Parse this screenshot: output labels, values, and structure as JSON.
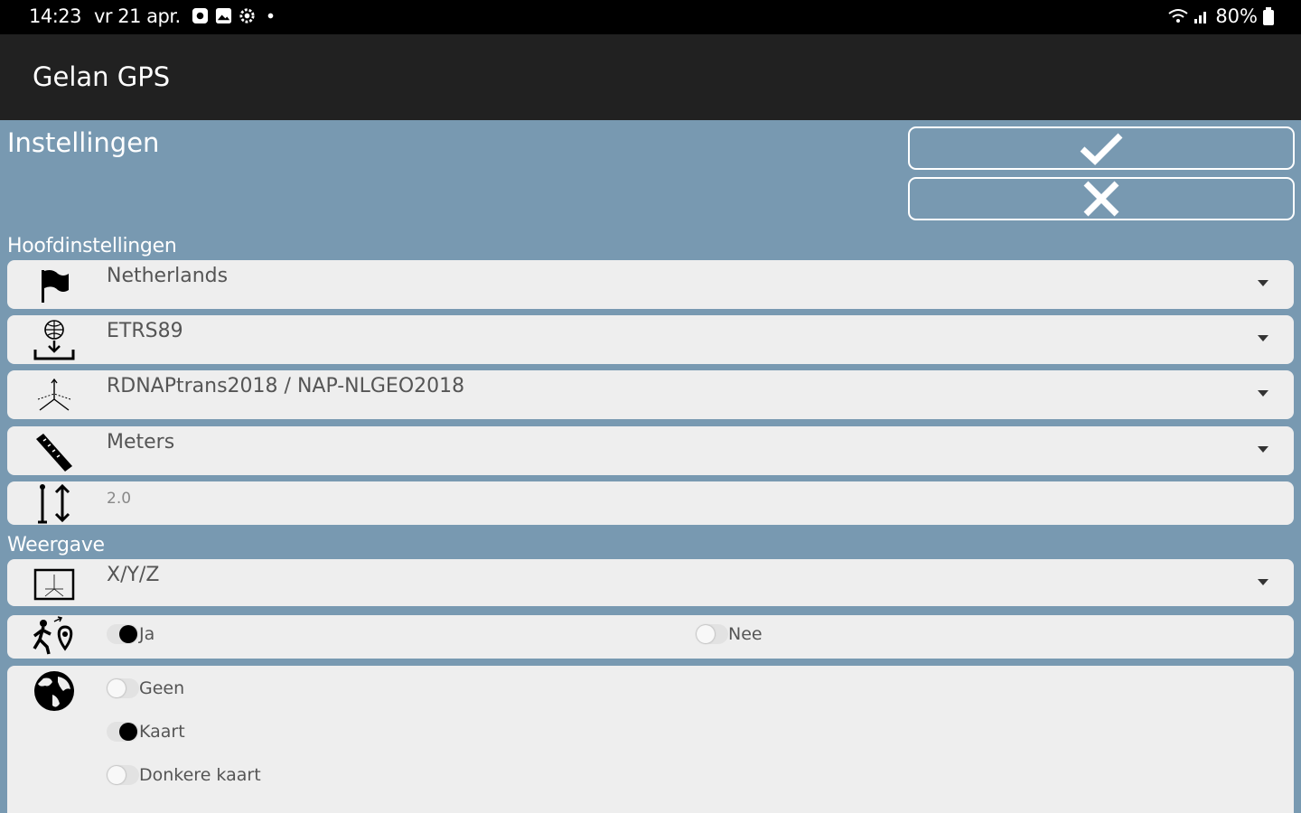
{
  "status_bar": {
    "time": "14:23",
    "date": "vr 21 apr.",
    "battery": "80%",
    "icons": [
      "notification-icon",
      "gallery-icon",
      "settings-gear-icon",
      "dot-icon",
      "wifi-icon",
      "signal-icon",
      "battery-icon"
    ]
  },
  "app": {
    "title": "Gelan GPS"
  },
  "page": {
    "title": "Instellingen"
  },
  "actions": {
    "confirm_icon": "checkmark-icon",
    "cancel_icon": "close-icon"
  },
  "sections": {
    "main_label": "Hoofdinstellingen",
    "display_label": "Weergave"
  },
  "settings": {
    "country": "Netherlands",
    "datum": "ETRS89",
    "transformation": "RDNAPtrans2018 / NAP-NLGEO2018",
    "unit": "Meters",
    "antenna_height": "2.0",
    "coordinate_display": "X/Y/Z"
  },
  "tracking": {
    "options": [
      {
        "label": "Ja",
        "selected": true
      },
      {
        "label": "Nee",
        "selected": false
      }
    ]
  },
  "map_type": {
    "options": [
      {
        "label": "Geen",
        "selected": false
      },
      {
        "label": "Kaart",
        "selected": true
      },
      {
        "label": "Donkere kaart",
        "selected": false
      }
    ]
  },
  "colors": {
    "background": "#7899b1",
    "app_bar": "#212121",
    "row_background": "#eeeeee"
  }
}
